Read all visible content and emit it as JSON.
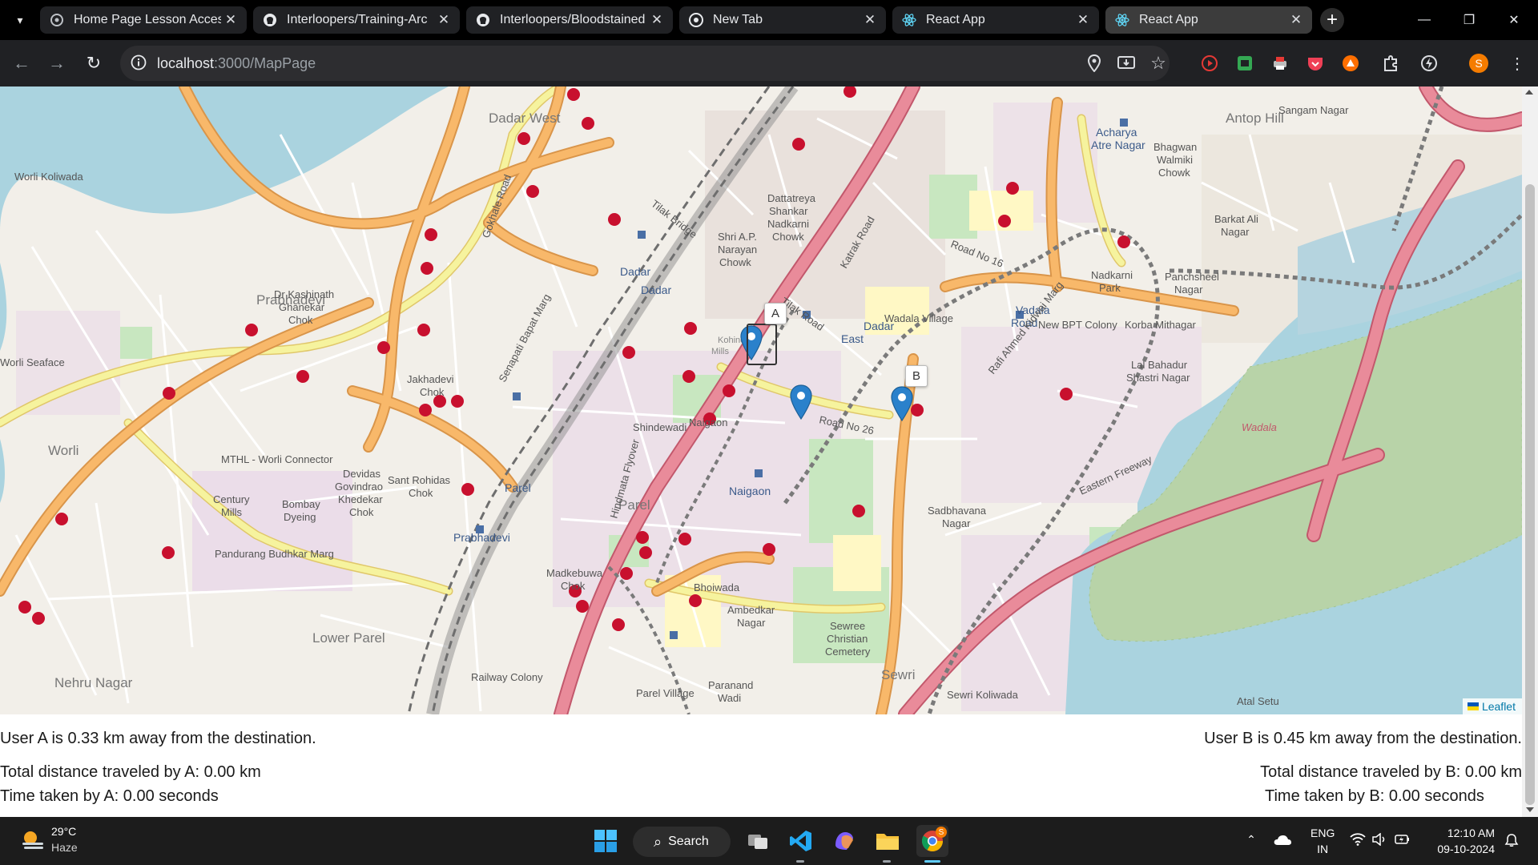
{
  "browser": {
    "tabs": [
      {
        "title": "Home Page Lesson Access",
        "icon": "chrome-settings-icon"
      },
      {
        "title": "Interloopers/Training-Arc",
        "icon": "github-icon"
      },
      {
        "title": "Interloopers/Bloodstained",
        "icon": "github-icon"
      },
      {
        "title": "New Tab",
        "icon": "chrome-icon"
      },
      {
        "title": "React App",
        "icon": "react-icon"
      },
      {
        "title": "React App",
        "icon": "react-icon",
        "active": true
      }
    ],
    "close_glyph": "✕",
    "new_tab_glyph": "+",
    "url_host": "localhost",
    "url_path": ":3000/MapPage",
    "profile_initial": "S"
  },
  "map": {
    "attribution": "Leaflet",
    "markers": [
      {
        "label": "A",
        "color": "#2a81cb"
      },
      {
        "label": "",
        "color": "#2a81cb"
      },
      {
        "label": "B",
        "color": "#2a81cb"
      }
    ],
    "place_labels": [
      "Dadar West",
      "Worli Koliwada",
      "Prabhadevi",
      "Worli",
      "Worli Seaface",
      "Dadar",
      "Dadar East",
      "Wadala Village",
      "Vadala Road",
      "Antop Hill",
      "Sangam Nagar",
      "Acharya Atre Nagar",
      "Bhagwan Walmiki Chowk",
      "Barkat Ali Nagar",
      "Nadkarni Park",
      "Panchsheel Nagar",
      "New BPT Colony",
      "Korba Mithagar",
      "Lal Bahadur Shastri Nagar",
      "Naigaon",
      "Shindewadi",
      "Parel",
      "Lower Parel",
      "Century Mills",
      "Bombay Dyeing",
      "Sant Rohidas Chok",
      "Devidas Govindrao Khedekar Chok",
      "Dr Kashinath Ghanekar Chok",
      "Jakhadevi Chok",
      "Madkebuwa Chok",
      "Bhoiwada",
      "Ambedkar Nagar",
      "Sewree Christian Cemetery",
      "Sewri",
      "Sewri Koliwada",
      "Sadbhavana Nagar",
      "Railway Colony",
      "Parel Village",
      "Paranand Wadi",
      "Nehru Nagar",
      "Dattatreya Shankar Nadkarni Chowk",
      "Shri A.P. Narayan Chowk",
      "Wadala",
      "Tilak Bridge",
      "Eastern Freeway",
      "Atal Setu",
      "Pandurang Budhkar Marg",
      "MTHL - Worli Connector",
      "Road No 26",
      "Road No 16",
      "Tilak Road",
      "Katrak Road",
      "Rafi Ahmed Kidwai Marg",
      "Senapati Bapat Marg",
      "Gokhale Road",
      "Hindmata Flyover",
      "Kohinoor Mills",
      "Naigaon",
      "Parel",
      "Prabhadevi",
      "Dadar"
    ]
  },
  "info": {
    "user_a_distance": "User A is 0.33 km away from the destination.",
    "user_b_distance": "User B is 0.45 km away from the destination.",
    "user_a_total": "Total distance traveled by A: 0.00 km",
    "user_b_total": "Total distance traveled by B: 0.00 km",
    "user_a_time": "Time taken by A: 0.00 seconds",
    "user_b_time": "Time taken by B: 0.00 seconds"
  },
  "taskbar": {
    "temperature": "29°C",
    "weather": "Haze",
    "search_label": "Search",
    "lang_top": "ENG",
    "lang_bottom": "IN",
    "time": "12:10 AM",
    "date": "09-10-2024",
    "chrome_badge": "S"
  },
  "colors": {
    "marker": "#2a81cb",
    "hospital": "#c8102e",
    "water": "#aad3df",
    "land": "#f2efe9",
    "park": "#c8e7c0",
    "railway": "#8c8c8c",
    "primary_road": "#f8b86a",
    "secondary_road": "#f6f39e",
    "trunk_road": "#e98b9a"
  }
}
